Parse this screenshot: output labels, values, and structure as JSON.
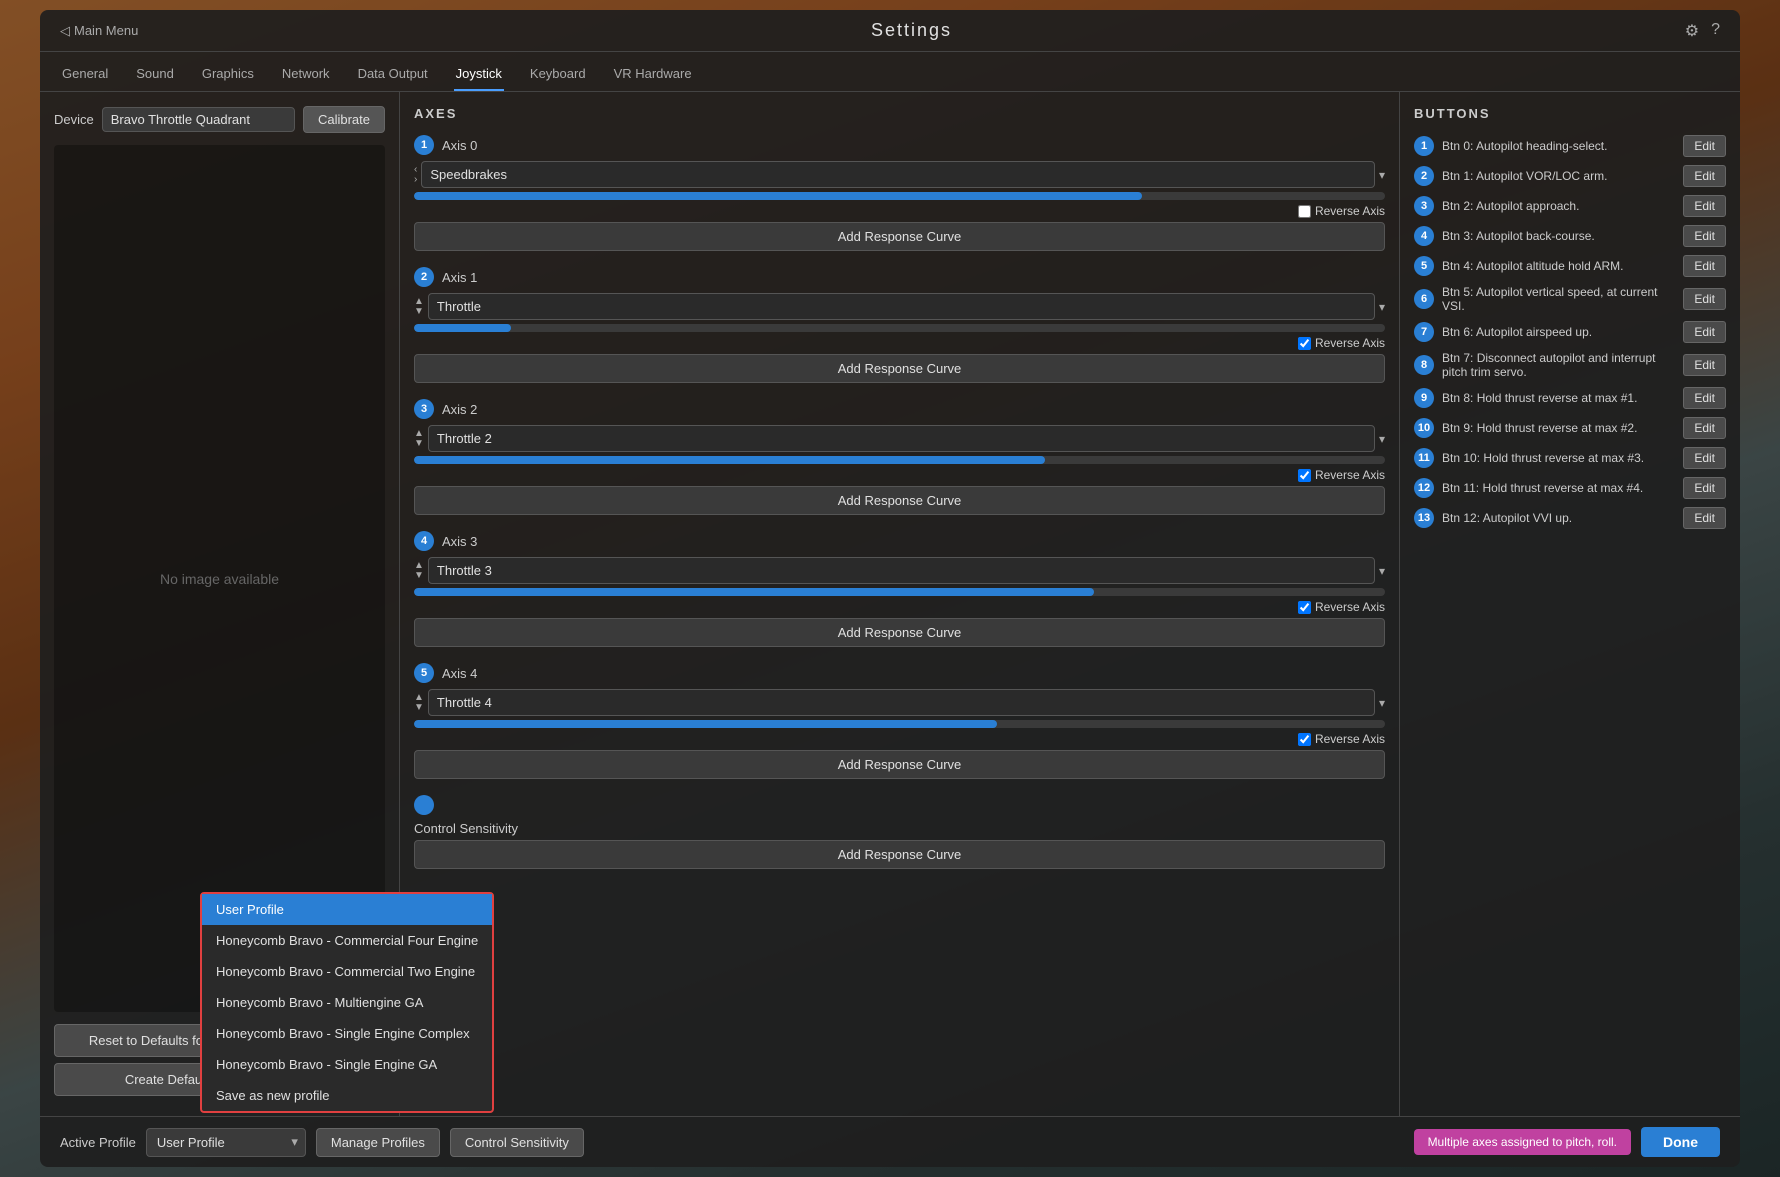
{
  "window": {
    "title": "Settings",
    "back_label": "Main Menu"
  },
  "tabs": [
    {
      "label": "General",
      "active": false
    },
    {
      "label": "Sound",
      "active": false
    },
    {
      "label": "Graphics",
      "active": false
    },
    {
      "label": "Network",
      "active": false
    },
    {
      "label": "Data Output",
      "active": false
    },
    {
      "label": "Joystick",
      "active": true
    },
    {
      "label": "Keyboard",
      "active": false
    },
    {
      "label": "VR Hardware",
      "active": false
    }
  ],
  "left_panel": {
    "device_label": "Device",
    "device_value": "Bravo Throttle Quadrant",
    "calibrate_label": "Calibrate",
    "no_image_text": "No image available",
    "reset_btn": "Reset to Defaults for Bravo Throttle Quadrant",
    "create_btn": "Create Default Configuration File"
  },
  "axes_section": {
    "title": "AXES",
    "axes": [
      {
        "num": "1",
        "name": "Axis 0",
        "assignment": "Speedbrakes",
        "bar_pct": 75,
        "reverse": false
      },
      {
        "num": "2",
        "name": "Axis 1",
        "assignment": "Throttle",
        "bar_pct": 10,
        "reverse": true
      },
      {
        "num": "3",
        "name": "Axis 2",
        "assignment": "Throttle 2",
        "bar_pct": 65,
        "reverse": true
      },
      {
        "num": "4",
        "name": "Axis 3",
        "assignment": "Throttle 3",
        "bar_pct": 70,
        "reverse": true
      },
      {
        "num": "5",
        "name": "Axis 4",
        "assignment": "Throttle 4",
        "bar_pct": 60,
        "reverse": true
      }
    ],
    "add_response_label": "Add Response Curve",
    "reverse_label": "Reverse Axis"
  },
  "buttons_section": {
    "title": "BUTTONS",
    "buttons": [
      {
        "num": "1",
        "label": "Btn 0: Autopilot heading-select.",
        "edit": "Edit"
      },
      {
        "num": "2",
        "label": "Btn 1: Autopilot VOR/LOC arm.",
        "edit": "Edit"
      },
      {
        "num": "3",
        "label": "Btn 2: Autopilot approach.",
        "edit": "Edit"
      },
      {
        "num": "4",
        "label": "Btn 3: Autopilot back-course.",
        "edit": "Edit"
      },
      {
        "num": "5",
        "label": "Btn 4: Autopilot altitude hold ARM.",
        "edit": "Edit"
      },
      {
        "num": "6",
        "label": "Btn 5: Autopilot vertical speed, at current VSI.",
        "edit": "Edit"
      },
      {
        "num": "7",
        "label": "Btn 6: Autopilot airspeed up.",
        "edit": "Edit"
      },
      {
        "num": "8",
        "label": "Btn 7: Disconnect autopilot and interrupt pitch trim servo.",
        "edit": "Edit"
      },
      {
        "num": "9",
        "label": "Btn 8: Hold thrust reverse at max #1.",
        "edit": "Edit"
      },
      {
        "num": "10",
        "label": "Btn 9: Hold thrust reverse at max #2.",
        "edit": "Edit"
      },
      {
        "num": "11",
        "label": "Btn 10: Hold thrust reverse at max #3.",
        "edit": "Edit"
      },
      {
        "num": "12",
        "label": "Btn 11: Hold thrust reverse at max #4.",
        "edit": "Edit"
      },
      {
        "num": "13",
        "label": "Btn 12: Autopilot VVI up.",
        "edit": "Edit"
      }
    ]
  },
  "bottom_bar": {
    "active_profile_label": "Active Profile",
    "profile_value": "User Profile",
    "manage_profiles_label": "Manage Profiles",
    "control_sensitivity_label": "Control Sensitivity",
    "warning_text": "Multiple axes assigned to pitch, roll.",
    "done_label": "Done"
  },
  "dropdown": {
    "items": [
      {
        "label": "User Profile",
        "selected": true
      },
      {
        "label": "Honeycomb Bravo - Commercial Four Engine",
        "selected": false
      },
      {
        "label": "Honeycomb Bravo - Commercial Two Engine",
        "selected": false
      },
      {
        "label": "Honeycomb Bravo - Multiengine GA",
        "selected": false
      },
      {
        "label": "Honeycomb Bravo - Single Engine Complex",
        "selected": false
      },
      {
        "label": "Honeycomb Bravo - Single Engine GA",
        "selected": false
      },
      {
        "label": "Save as new profile",
        "selected": false
      }
    ]
  },
  "icons": {
    "back": "◁",
    "settings": "⚙",
    "question": "?",
    "chevron_down": "▾",
    "chevron_right": "›",
    "up_arrow": "▲",
    "down_arrow": "▼"
  }
}
